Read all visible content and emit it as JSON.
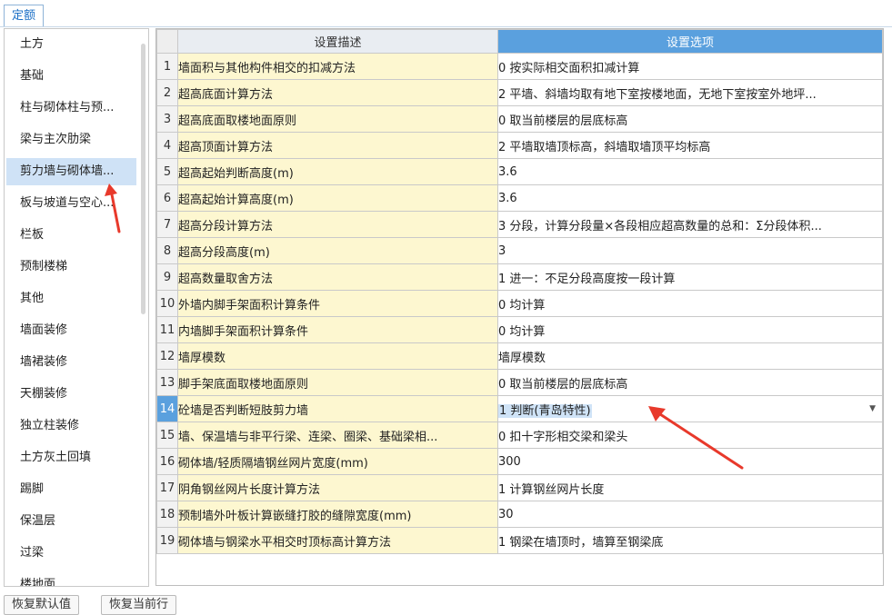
{
  "tab": {
    "label": "定额"
  },
  "sidebar": {
    "items": [
      {
        "label": "土方"
      },
      {
        "label": "基础"
      },
      {
        "label": "柱与砌体柱与预..."
      },
      {
        "label": "梁与主次肋梁"
      },
      {
        "label": "剪力墙与砌体墙..."
      },
      {
        "label": "板与坡道与空心..."
      },
      {
        "label": "栏板"
      },
      {
        "label": "预制楼梯"
      },
      {
        "label": "其他"
      },
      {
        "label": "墙面装修"
      },
      {
        "label": "墙裙装修"
      },
      {
        "label": "天棚装修"
      },
      {
        "label": "独立柱装修"
      },
      {
        "label": "土方灰土回填"
      },
      {
        "label": "踢脚"
      },
      {
        "label": "保温层"
      },
      {
        "label": "过梁"
      },
      {
        "label": "楼地面"
      }
    ],
    "selected_index": 4
  },
  "grid": {
    "header_desc": "设置描述",
    "header_option": "设置选项",
    "active_row": 14,
    "rows": [
      {
        "num": "1",
        "desc": "墙面积与其他构件相交的扣减方法",
        "option": "0 按实际相交面积扣减计算"
      },
      {
        "num": "2",
        "desc": "超高底面计算方法",
        "option": "2 平墙、斜墙均取有地下室按楼地面，无地下室按室外地坪..."
      },
      {
        "num": "3",
        "desc": "超高底面取楼地面原则",
        "option": "0 取当前楼层的层底标高"
      },
      {
        "num": "4",
        "desc": "超高顶面计算方法",
        "option": "2 平墙取墙顶标高，斜墙取墙顶平均标高"
      },
      {
        "num": "5",
        "desc": "超高起始判断高度(m)",
        "option": "3.6"
      },
      {
        "num": "6",
        "desc": "超高起始计算高度(m)",
        "option": "3.6"
      },
      {
        "num": "7",
        "desc": "超高分段计算方法",
        "option": "3 分段，计算分段量×各段相应超高数量的总和：Σ分段体积..."
      },
      {
        "num": "8",
        "desc": "超高分段高度(m)",
        "option": "3"
      },
      {
        "num": "9",
        "desc": "超高数量取舍方法",
        "option": "1 进一：不足分段高度按一段计算"
      },
      {
        "num": "10",
        "desc": "外墙内脚手架面积计算条件",
        "option": "0 均计算"
      },
      {
        "num": "11",
        "desc": "内墙脚手架面积计算条件",
        "option": "0 均计算"
      },
      {
        "num": "12",
        "desc": "墙厚模数",
        "option": "墙厚模数"
      },
      {
        "num": "13",
        "desc": "脚手架底面取楼地面原则",
        "option": "0 取当前楼层的层底标高"
      },
      {
        "num": "14",
        "desc": "砼墙是否判断短肢剪力墙",
        "option": "1 判断(青岛特性)"
      },
      {
        "num": "15",
        "desc": "墙、保温墙与非平行梁、连梁、圈梁、基础梁相...",
        "option": "0 扣十字形相交梁和梁头"
      },
      {
        "num": "16",
        "desc": "砌体墙/轻质隔墙钢丝网片宽度(mm)",
        "option": "300"
      },
      {
        "num": "17",
        "desc": "阴角钢丝网片长度计算方法",
        "option": "1 计算钢丝网片长度"
      },
      {
        "num": "18",
        "desc": "预制墙外叶板计算嵌缝打胶的缝隙宽度(mm)",
        "option": "30"
      },
      {
        "num": "19",
        "desc": "砌体墙与钢梁水平相交时顶标高计算方法",
        "option": "1 钢梁在墙顶时，墙算至钢梁底"
      }
    ]
  },
  "buttons": {
    "restore_default": "恢复默认值",
    "restore_row": "恢复当前行"
  },
  "colors": {
    "accent": "#5aa0de",
    "selected_bg": "#cfe2f6",
    "desc_bg": "#fdf7d0",
    "arrow": "#e8392b"
  }
}
